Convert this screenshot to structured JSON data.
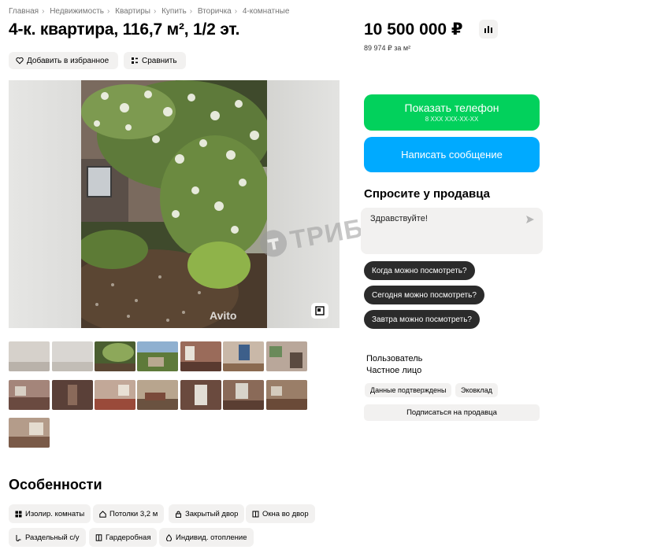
{
  "breadcrumbs": [
    "Главная",
    "Недвижимость",
    "Квартиры",
    "Купить",
    "Вторичка",
    "4-комнатные"
  ],
  "title": "4-к. квартира, 116,7 м², 1/2 эт.",
  "actions": {
    "favorite": "Добавить в избранное",
    "compare": "Сравнить"
  },
  "gallery": {
    "brand_mark": "Avito",
    "thumbnail_count": 15
  },
  "watermark": "ТРИБУН",
  "price": {
    "value": "10 500 000 ₽",
    "per_m2": "89 974 ₽ за м²"
  },
  "contact": {
    "phone_label": "Показать телефон",
    "phone_masked": "8 XXX XXX-XX-XX",
    "message_label": "Написать сообщение"
  },
  "ask": {
    "title": "Спросите у продавца",
    "message": "Здравствуйте!",
    "quick_questions": [
      "Когда можно посмотреть?",
      "Сегодня можно посмотреть?",
      "Завтра можно посмотреть?"
    ]
  },
  "seller": {
    "type": "Пользователь",
    "name": "Частное лицо",
    "badges": [
      "Данные подтверждены",
      "Эковклад"
    ],
    "subscribe_label": "Подписаться на продавца"
  },
  "features": {
    "title": "Особенности",
    "items": [
      "Изолир. комнаты",
      "Потолки 3,2 м",
      "Закрытый двор",
      "Окна во двор",
      "Раздельный с/у",
      "Гардеробная",
      "Индивид. отопление"
    ]
  },
  "colors": {
    "phone_button": "#02d15c",
    "message_button": "#00aaff",
    "chip_dark": "#2b2b2b",
    "chip_light": "#f2f1f0"
  }
}
